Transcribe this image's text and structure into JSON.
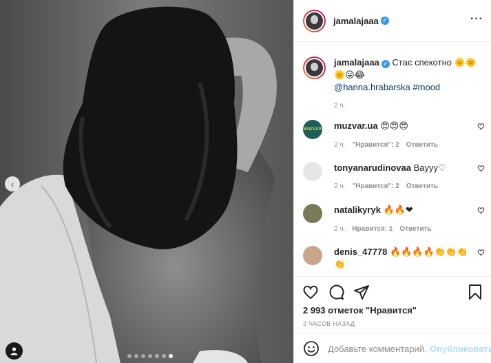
{
  "post": {
    "username": "jamalajaaa",
    "verified": true,
    "more_label": "···",
    "carousel": {
      "total": 7,
      "active_index": 6,
      "prev_arrow": "‹"
    }
  },
  "caption": {
    "username": "jamalajaaa",
    "text": "Стає спекотно",
    "emoji_line1": "🌞🌞",
    "emoji_line2": "🌞😛😂",
    "mention": "@hanna.hrabarska",
    "hashtag": "#mood",
    "time": "2 ч."
  },
  "comments": [
    {
      "username": "muzvar.ua",
      "avatar_text": "MUZVAR",
      "text": "",
      "emoji": "😍😍😍",
      "time": "2 ч.",
      "likes": "\"Нравится\": 2",
      "reply": "Ответить"
    },
    {
      "username": "tonyanarudinovaa",
      "avatar_text": "",
      "text": "Bayyy♡",
      "emoji": "",
      "time": "2 ч.",
      "likes": "\"Нравится\": 2",
      "reply": "Ответить"
    },
    {
      "username": "natalikyryk",
      "avatar_text": "",
      "text": "",
      "emoji": "🔥🔥❤",
      "time": "2 ч.",
      "likes": "Нравится: 1",
      "reply": "Ответить"
    },
    {
      "username": "denis_47778",
      "avatar_text": "",
      "text": "",
      "emoji": "🔥🔥🔥🔥👏👏👏",
      "emoji2": "👏",
      "time": "",
      "likes": "",
      "reply": ""
    }
  ],
  "actions": {
    "likes_count": "2 993 отметок \"Нравится\"",
    "posted": "2 ЧАСОВ НАЗАД"
  },
  "add_comment": {
    "placeholder": "Добавьте комментарий...",
    "post_label": "Опубликовать"
  },
  "colors": {
    "link": "#00376b",
    "verified": "#3897f0",
    "post_button": "#b2dffc",
    "muted": "#8e8e8e"
  }
}
